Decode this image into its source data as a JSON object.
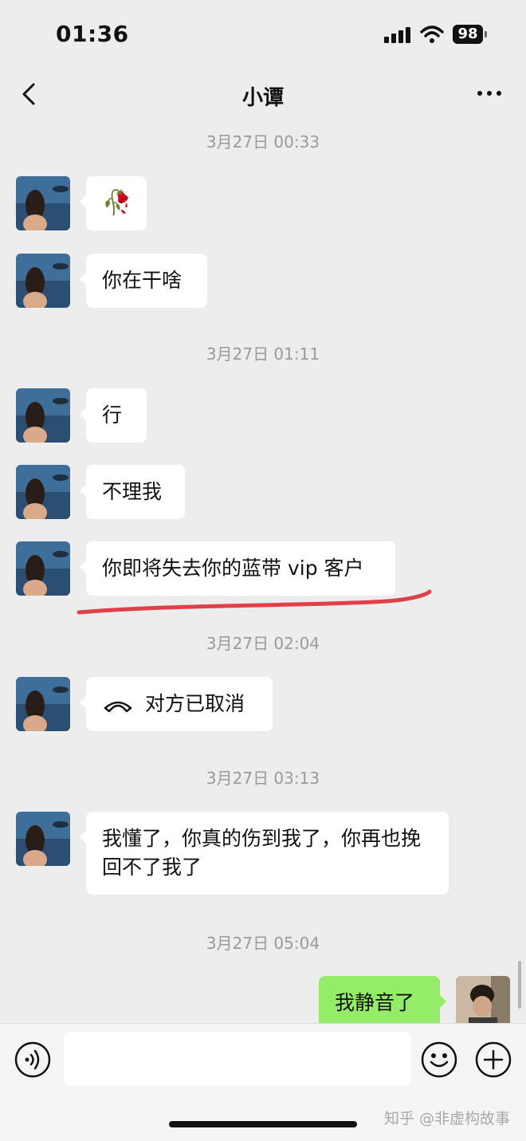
{
  "status_bar": {
    "time": "01:36",
    "battery": "98"
  },
  "header": {
    "title": "小谭"
  },
  "messages": [
    {
      "timestamp": "3月27日 00:33"
    },
    {
      "text": "🥀"
    },
    {
      "text": "你在干啥"
    },
    {
      "timestamp": "3月27日 01:11"
    },
    {
      "text": "行"
    },
    {
      "text": "不理我"
    },
    {
      "text": "你即将失去你的蓝带 vip 客户"
    },
    {
      "timestamp": "3月27日 02:04"
    },
    {
      "text": "对方已取消"
    },
    {
      "timestamp": "3月27日 03:13"
    },
    {
      "text": "我懂了，你真的伤到我了，你再也挽回不了我了"
    },
    {
      "timestamp": "3月27日 05:04"
    },
    {
      "text": "我静音了"
    }
  ],
  "annotation_color": "#e0404a",
  "sent_bubble_color": "#95ec69",
  "watermark": "知乎 @非虚构故事",
  "icons": {
    "back": "chevron-left-icon",
    "more": "more-dots-icon",
    "voice": "voice-icon",
    "emoji": "emoji-icon",
    "plus": "plus-icon",
    "call": "phone-hangup-icon"
  }
}
